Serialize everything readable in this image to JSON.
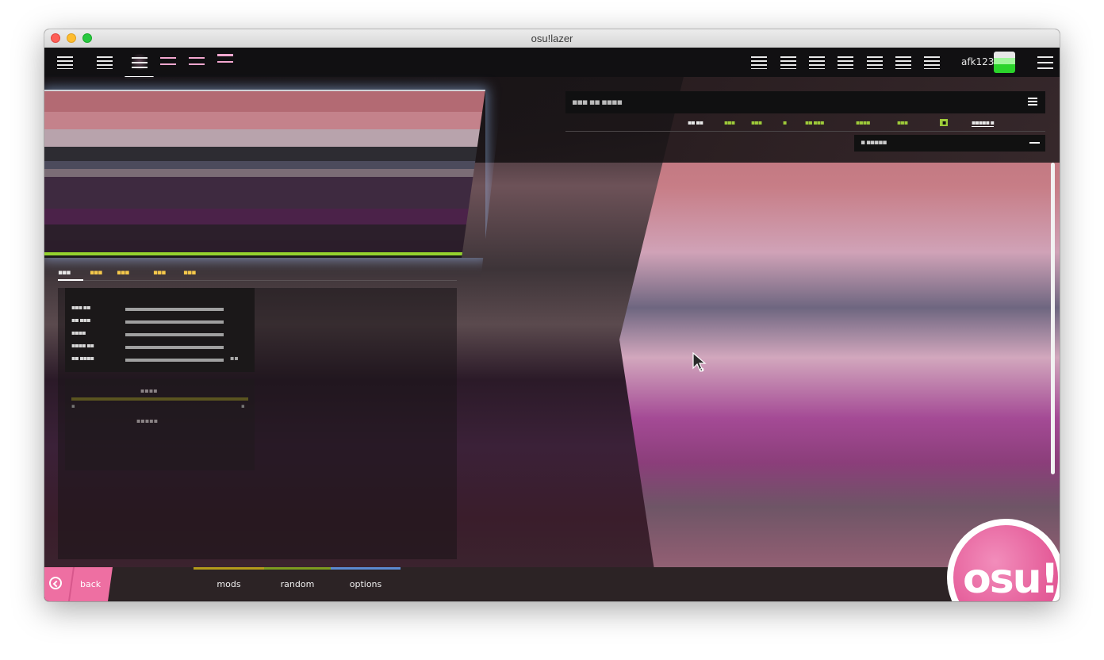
{
  "window": {
    "title": "osu!lazer"
  },
  "toolbar": {
    "user": {
      "name": "afk123"
    }
  },
  "beatmap_details": {
    "tabs": [
      {
        "label": "▪▪▪"
      },
      {
        "label": "▪▪▪"
      },
      {
        "label": "▪▪▪"
      },
      {
        "label": "▪▪▪"
      },
      {
        "label": "▪▪▪"
      }
    ],
    "stats": [
      {
        "label": "▪▪▪ ▪▪",
        "value": ""
      },
      {
        "label": "▪▪ ▪▪▪",
        "value": ""
      },
      {
        "label": "▪▪▪▪",
        "value": ""
      },
      {
        "label": "▪▪▪▪ ▪▪",
        "value": ""
      },
      {
        "label": "▪▪ ▪▪▪▪",
        "value": "▪▪"
      }
    ]
  },
  "song_select": {
    "search_placeholder": "▪▪▪ ▪▪ ▪▪▪▪",
    "sort_label": "▪ ▪▪▪▪▪"
  },
  "footer": {
    "back_label": "back",
    "buttons": [
      {
        "label": "mods",
        "color": "#b39a1b"
      },
      {
        "label": "random",
        "color": "#7c9a20"
      },
      {
        "label": "options",
        "color": "#5b8ad1"
      }
    ]
  },
  "logo": {
    "text": "osu!"
  },
  "colors": {
    "accent": "#ee6fa2",
    "highlight": "#9ecb3a"
  }
}
